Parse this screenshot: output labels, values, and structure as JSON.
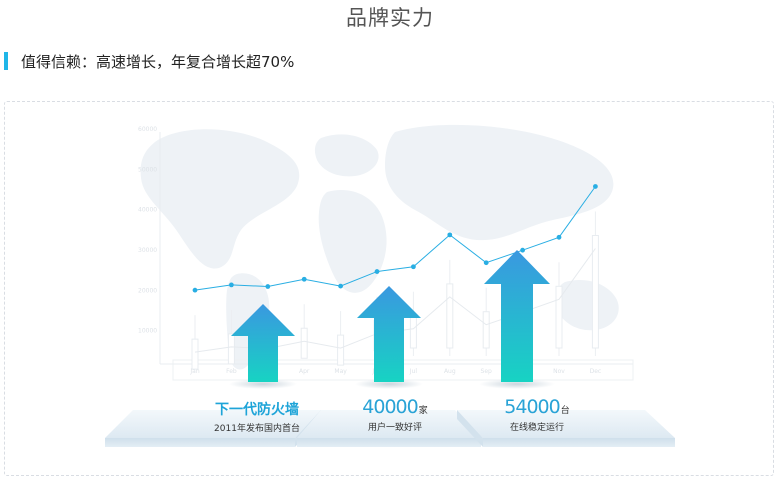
{
  "page": {
    "title": "品牌实力",
    "subtitle": "值得信赖：高速增长，年复合增长超70%"
  },
  "colors": {
    "accent": "#1fb6e8",
    "line": "#29aee3",
    "arrow_top": "#2f9fe0",
    "arrow_bottom": "#1cd0c4",
    "platform": "#e6eff6"
  },
  "chart_data": {
    "type": "line",
    "categories": [
      "Jan",
      "Feb",
      "Mar",
      "Apr",
      "May",
      "Jun",
      "Jul",
      "Aug",
      "Sep",
      "Oct",
      "Nov",
      "Dec"
    ],
    "y_ticks": [
      "60000",
      "50000",
      "40000",
      "30000",
      "20000",
      "10000"
    ],
    "series": [
      {
        "values": [
          19800,
          21100,
          20700,
          22500,
          20800,
          24400,
          25600,
          33500,
          26600,
          29700,
          32900,
          45500
        ]
      }
    ],
    "ylim": [
      0,
      60000
    ],
    "grid": false
  },
  "highlights": [
    {
      "headline": "下一代防火墙",
      "desc": "2011年发布国内首台"
    },
    {
      "number": "40000",
      "unit": "家",
      "desc": "用户一致好评"
    },
    {
      "number": "54000",
      "unit": "台",
      "desc": "在线稳定运行"
    }
  ]
}
